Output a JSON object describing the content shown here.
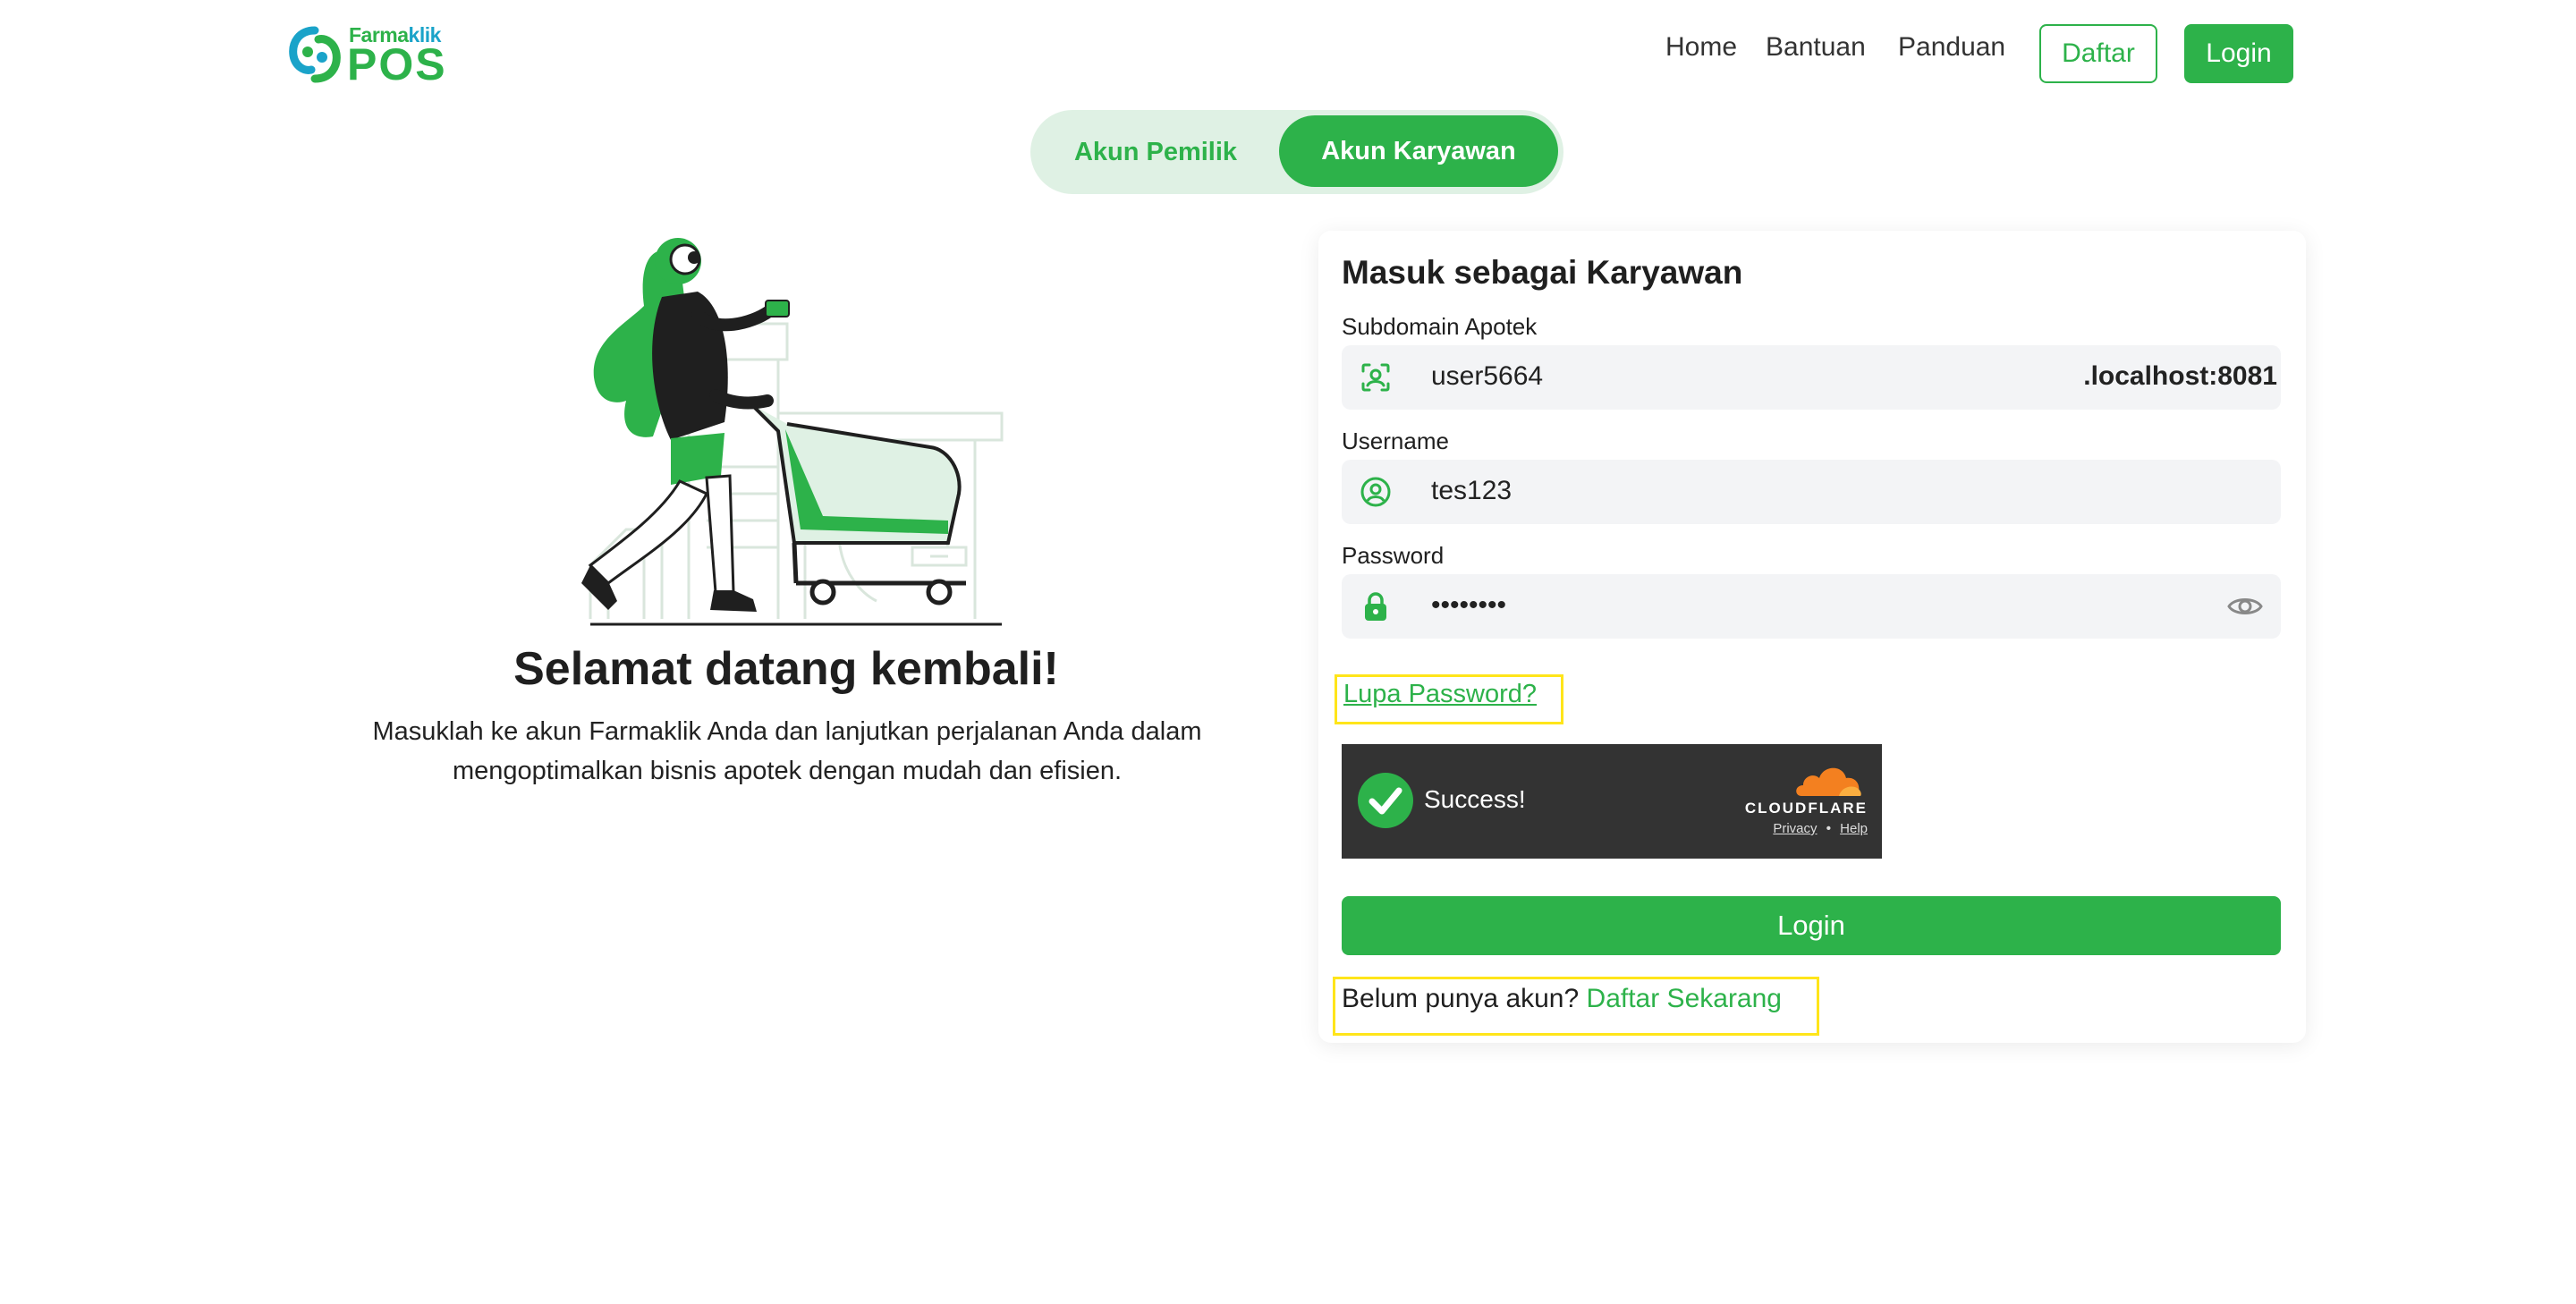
{
  "brand": {
    "top_main": "Farma",
    "top_tail": "klik",
    "name": "POS"
  },
  "nav": {
    "links": [
      "Home",
      "Bantuan",
      "Panduan"
    ],
    "daftar_label": "Daftar",
    "login_label": "Login"
  },
  "tabs": {
    "owner": "Akun Pemilik",
    "employee": "Akun Karyawan",
    "active": "employee"
  },
  "hero": {
    "title": "Selamat datang kembali!",
    "desc_line1": "Masuklah ke akun Farmaklik Anda dan lanjutkan perjalanan Anda dalam",
    "desc_line2": "mengoptimalkan bisnis apotek dengan mudah dan efisien."
  },
  "form": {
    "title": "Masuk sebagai Karyawan",
    "subdomain": {
      "label": "Subdomain Apotek",
      "value": "user5664",
      "suffix": ".localhost:8081"
    },
    "username": {
      "label": "Username",
      "value": "tes123"
    },
    "password": {
      "label": "Password",
      "value": "••••••••"
    },
    "forgot_label": "Lupa Password?",
    "captcha": {
      "status": "Success!",
      "brand": "CLOUDFLARE",
      "privacy": "Privacy",
      "separator": "•",
      "help": "Help"
    },
    "submit_label": "Login",
    "signup_prompt": "Belum punya akun?",
    "signup_link": "Daftar Sekarang"
  },
  "colors": {
    "primary": "#2db24a",
    "accent": "#1aa3c9",
    "highlight": "#ffe51a"
  }
}
